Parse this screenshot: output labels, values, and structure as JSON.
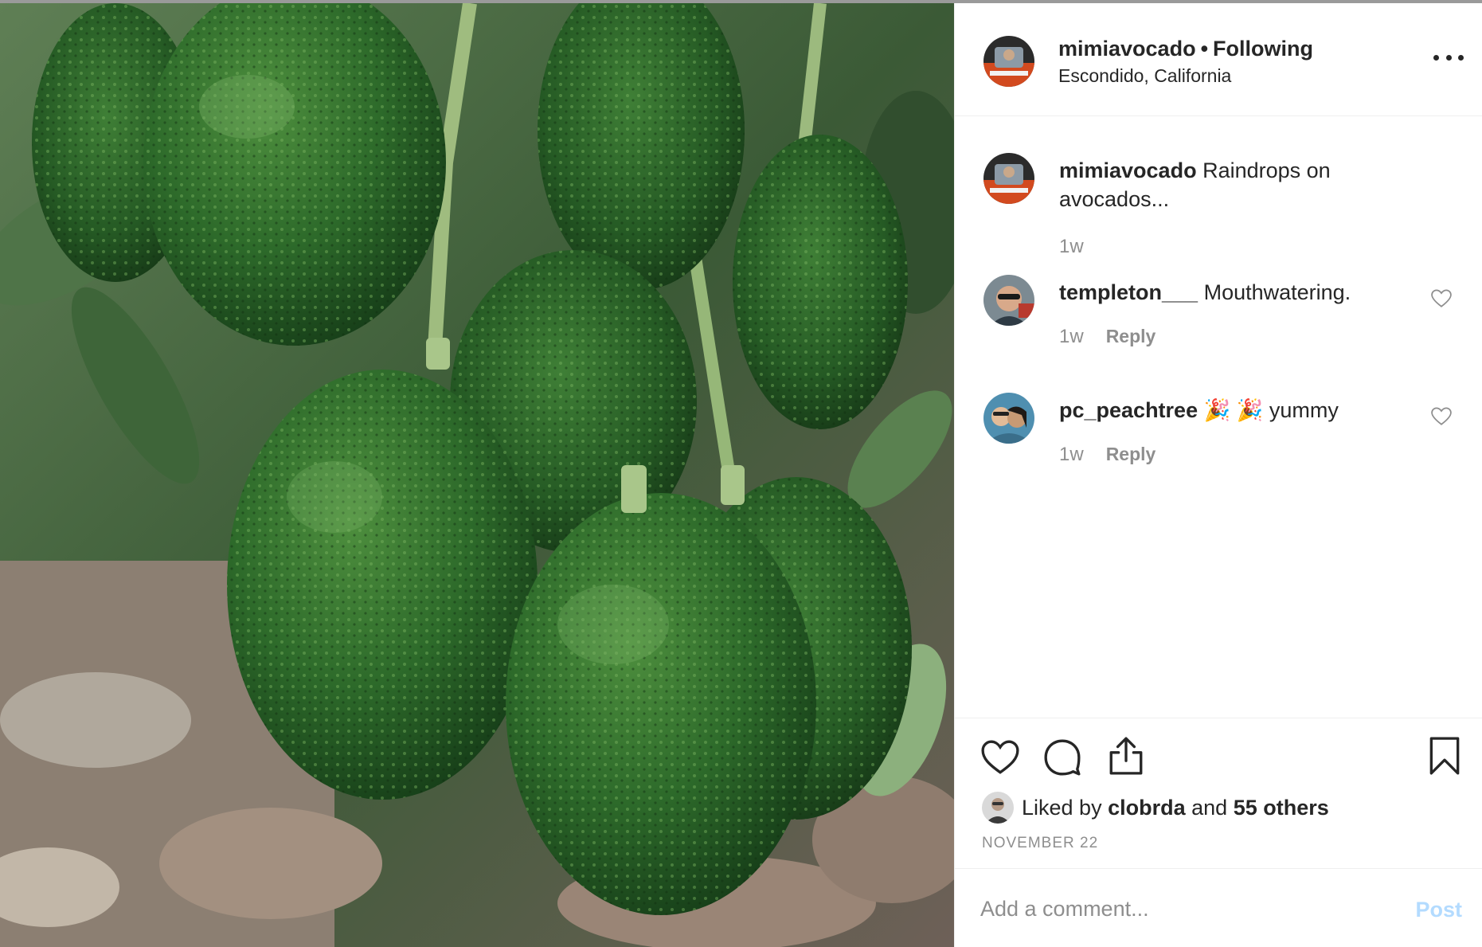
{
  "post": {
    "photo_alt": "avocados-photo",
    "header": {
      "username": "mimiavocado",
      "separator": "•",
      "follow_status": "Following",
      "location": "Escondido, California",
      "more_icon": "more-options-icon"
    },
    "caption": {
      "username": "mimiavocado",
      "text": "Raindrops on avocados...",
      "time": "1w"
    },
    "comments": [
      {
        "username": "templeton___",
        "text": "Mouthwatering.",
        "time": "1w",
        "reply_label": "Reply",
        "like_icon": "heart-outline-icon"
      },
      {
        "username": "pc_peachtree",
        "text": "🎉 🎉 yummy",
        "time": "1w",
        "reply_label": "Reply",
        "like_icon": "heart-outline-icon"
      }
    ],
    "actions": {
      "like_icon": "heart-outline-icon",
      "comment_icon": "speech-bubble-icon",
      "share_icon": "share-upload-icon",
      "save_icon": "bookmark-icon"
    },
    "likes": {
      "prefix": "Liked by",
      "user": "clobrda",
      "and": "and",
      "others": "55 others"
    },
    "date": "NOVEMBER 22",
    "add_comment": {
      "placeholder": "Add a comment...",
      "post_label": "Post"
    }
  },
  "colors": {
    "text": "#262626",
    "muted": "#8e8e8e",
    "post_disabled": "#b3dbff",
    "divider": "#efefef",
    "avocado": "#2f6b2c"
  }
}
